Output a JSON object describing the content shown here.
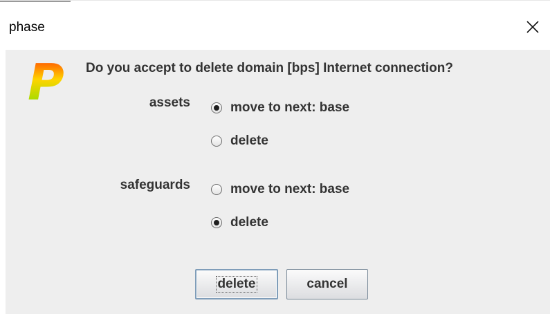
{
  "window": {
    "title": "phase"
  },
  "dialog": {
    "question": "Do you accept to delete domain [bps] Internet connection?",
    "groups": [
      {
        "label": "assets",
        "options": [
          {
            "label": "move to next: base",
            "selected": true
          },
          {
            "label": "delete",
            "selected": false
          }
        ]
      },
      {
        "label": "safeguards",
        "options": [
          {
            "label": "move to next: base",
            "selected": false
          },
          {
            "label": "delete",
            "selected": true
          }
        ]
      }
    ],
    "buttons": {
      "delete": "delete",
      "cancel": "cancel"
    }
  },
  "icons": {
    "logo": "phase-logo-icon",
    "close": "close-icon",
    "logo_letter": "P"
  },
  "colors": {
    "dialog_bg": "#eeeeee",
    "logo_gradient": [
      "#ff2a00",
      "#ffd400",
      "#7adf00"
    ]
  }
}
